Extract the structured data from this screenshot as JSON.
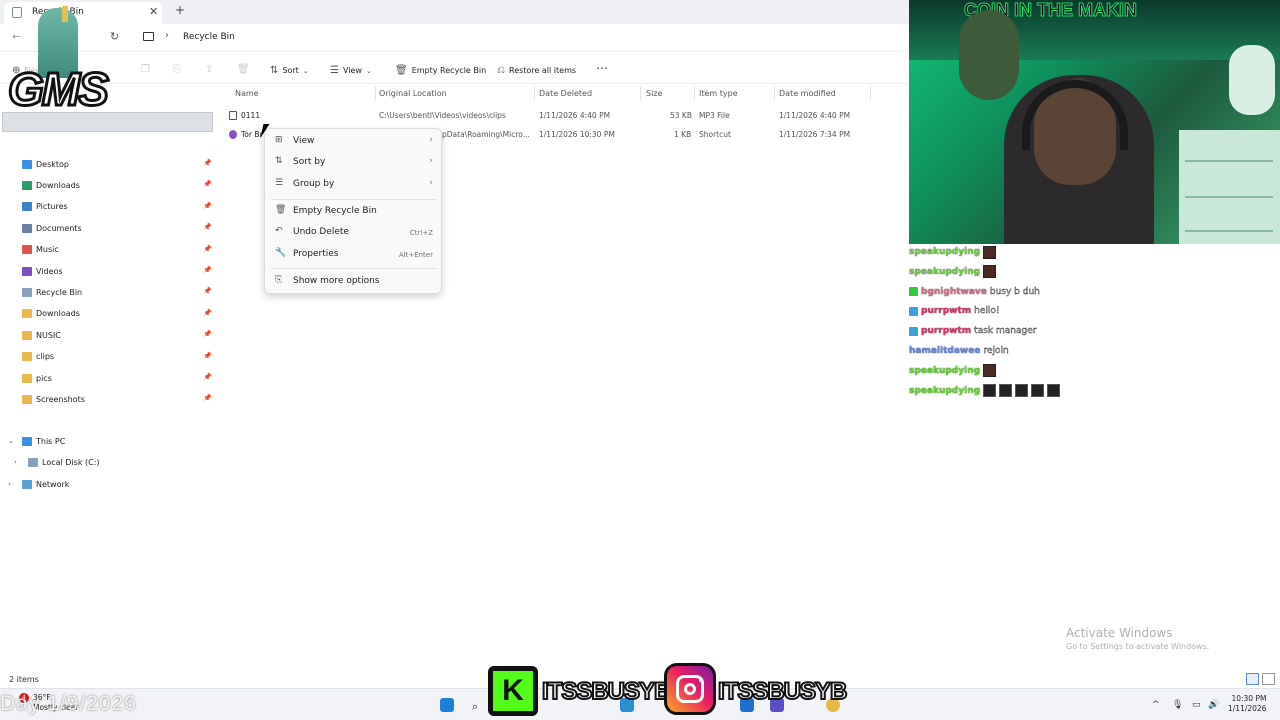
{
  "window": {
    "tab_title": "Recycle Bin",
    "breadcrumb": "Recycle Bin"
  },
  "toolbar": {
    "new": "New",
    "sort": "Sort",
    "view": "View",
    "empty": "Empty Recycle Bin",
    "restore": "Restore all items"
  },
  "sidebar": {
    "quick": [
      {
        "label": "Desktop",
        "color": "#3a8ee6"
      },
      {
        "label": "Downloads",
        "color": "#2a9d6a"
      },
      {
        "label": "Pictures",
        "color": "#3b82c4"
      },
      {
        "label": "Documents",
        "color": "#6b7fa0"
      },
      {
        "label": "Music",
        "color": "#d9534f"
      },
      {
        "label": "Videos",
        "color": "#7b4fc9"
      },
      {
        "label": "Recycle Bin",
        "color": "#8aa0b8"
      },
      {
        "label": "Downloads",
        "color": "#e8b84a"
      },
      {
        "label": "NUSIC",
        "color": "#e8b84a"
      },
      {
        "label": "clips",
        "color": "#e8b84a"
      },
      {
        "label": "pics",
        "color": "#e8b84a"
      },
      {
        "label": "Screenshots",
        "color": "#e8b84a"
      }
    ],
    "this_pc": "This PC",
    "local_disk": "Local Disk (C:)",
    "network": "Network"
  },
  "columns": {
    "name": "Name",
    "original_location": "Original Location",
    "date_deleted": "Date Deleted",
    "size": "Size",
    "item_type": "Item type",
    "date_modified": "Date modified"
  },
  "files": [
    {
      "name": "0111",
      "location": "C:\\Users\\bentl\\Videos\\videos\\clips",
      "deleted": "1/11/2026 4:40 PM",
      "size": "53 KB",
      "type": "MP3 File",
      "modified": "1/11/2026 4:40 PM"
    },
    {
      "name": "Tor Br",
      "location": "pData\\Roaming\\Micro...",
      "deleted": "1/11/2026 10:30 PM",
      "size": "1 KB",
      "type": "Shortcut",
      "modified": "1/11/2026 7:34 PM"
    }
  ],
  "context_menu": {
    "view": "View",
    "sort_by": "Sort by",
    "group_by": "Group by",
    "empty": "Empty Recycle Bin",
    "undo": "Undo Delete",
    "undo_shortcut": "Ctrl+Z",
    "properties": "Properties",
    "properties_shortcut": "Alt+Enter",
    "more": "Show more options"
  },
  "status": {
    "count": "2 items"
  },
  "activate": {
    "title": "Activate Windows",
    "sub": "Go to Settings to activate Windows."
  },
  "taskbar": {
    "temp": "36°F",
    "condition": "Mostly clear",
    "badge": "4",
    "time": "10:30 PM",
    "date": "1/11/2026"
  },
  "overlay": {
    "date": "Day 1/9/2026",
    "logo": "GMS",
    "kick_letter": "K",
    "handle_kick": "ITSSBUSYB",
    "handle_ig": "ITSSBUSYB",
    "banner": "COIN IN THE MAKIN"
  },
  "chat": [
    {
      "user": "speakupdying",
      "color": "#6cd63a",
      "text": "",
      "emotes": 1
    },
    {
      "user": "speakupdying",
      "color": "#6cd63a",
      "text": "",
      "emotes": 1
    },
    {
      "user": "bgnightwave",
      "color": "#e06a8a",
      "text": "busy b duh",
      "emotes": 0
    },
    {
      "user": "purrpwtm",
      "color": "#d9366a",
      "text": "hello!",
      "emotes": 0
    },
    {
      "user": "purrpwtm",
      "color": "#d9366a",
      "text": "task manager",
      "emotes": 0
    },
    {
      "user": "hamalitdawee",
      "color": "#6a8ad9",
      "text": "rejoin",
      "emotes": 0
    },
    {
      "user": "speakupdying",
      "color": "#6cd63a",
      "text": "",
      "emotes": 1
    },
    {
      "user": "speakupdying",
      "color": "#6cd63a",
      "text": "",
      "emotes": 5
    }
  ]
}
